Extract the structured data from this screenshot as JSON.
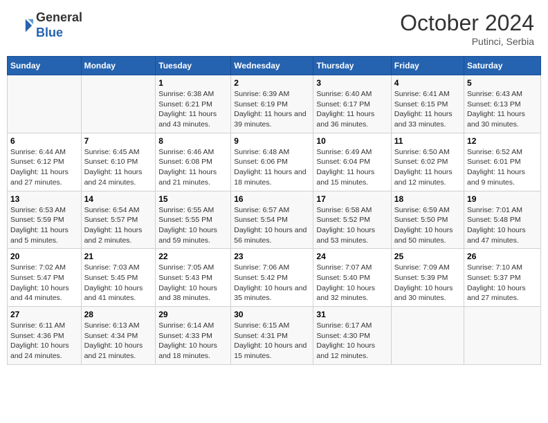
{
  "header": {
    "logo_line1": "General",
    "logo_line2": "Blue",
    "month_title": "October 2024",
    "location": "Putinci, Serbia"
  },
  "weekdays": [
    "Sunday",
    "Monday",
    "Tuesday",
    "Wednesday",
    "Thursday",
    "Friday",
    "Saturday"
  ],
  "weeks": [
    [
      {
        "day": "",
        "sunrise": "",
        "sunset": "",
        "daylight": ""
      },
      {
        "day": "",
        "sunrise": "",
        "sunset": "",
        "daylight": ""
      },
      {
        "day": "1",
        "sunrise": "Sunrise: 6:38 AM",
        "sunset": "Sunset: 6:21 PM",
        "daylight": "Daylight: 11 hours and 43 minutes."
      },
      {
        "day": "2",
        "sunrise": "Sunrise: 6:39 AM",
        "sunset": "Sunset: 6:19 PM",
        "daylight": "Daylight: 11 hours and 39 minutes."
      },
      {
        "day": "3",
        "sunrise": "Sunrise: 6:40 AM",
        "sunset": "Sunset: 6:17 PM",
        "daylight": "Daylight: 11 hours and 36 minutes."
      },
      {
        "day": "4",
        "sunrise": "Sunrise: 6:41 AM",
        "sunset": "Sunset: 6:15 PM",
        "daylight": "Daylight: 11 hours and 33 minutes."
      },
      {
        "day": "5",
        "sunrise": "Sunrise: 6:43 AM",
        "sunset": "Sunset: 6:13 PM",
        "daylight": "Daylight: 11 hours and 30 minutes."
      }
    ],
    [
      {
        "day": "6",
        "sunrise": "Sunrise: 6:44 AM",
        "sunset": "Sunset: 6:12 PM",
        "daylight": "Daylight: 11 hours and 27 minutes."
      },
      {
        "day": "7",
        "sunrise": "Sunrise: 6:45 AM",
        "sunset": "Sunset: 6:10 PM",
        "daylight": "Daylight: 11 hours and 24 minutes."
      },
      {
        "day": "8",
        "sunrise": "Sunrise: 6:46 AM",
        "sunset": "Sunset: 6:08 PM",
        "daylight": "Daylight: 11 hours and 21 minutes."
      },
      {
        "day": "9",
        "sunrise": "Sunrise: 6:48 AM",
        "sunset": "Sunset: 6:06 PM",
        "daylight": "Daylight: 11 hours and 18 minutes."
      },
      {
        "day": "10",
        "sunrise": "Sunrise: 6:49 AM",
        "sunset": "Sunset: 6:04 PM",
        "daylight": "Daylight: 11 hours and 15 minutes."
      },
      {
        "day": "11",
        "sunrise": "Sunrise: 6:50 AM",
        "sunset": "Sunset: 6:02 PM",
        "daylight": "Daylight: 11 hours and 12 minutes."
      },
      {
        "day": "12",
        "sunrise": "Sunrise: 6:52 AM",
        "sunset": "Sunset: 6:01 PM",
        "daylight": "Daylight: 11 hours and 9 minutes."
      }
    ],
    [
      {
        "day": "13",
        "sunrise": "Sunrise: 6:53 AM",
        "sunset": "Sunset: 5:59 PM",
        "daylight": "Daylight: 11 hours and 5 minutes."
      },
      {
        "day": "14",
        "sunrise": "Sunrise: 6:54 AM",
        "sunset": "Sunset: 5:57 PM",
        "daylight": "Daylight: 11 hours and 2 minutes."
      },
      {
        "day": "15",
        "sunrise": "Sunrise: 6:55 AM",
        "sunset": "Sunset: 5:55 PM",
        "daylight": "Daylight: 10 hours and 59 minutes."
      },
      {
        "day": "16",
        "sunrise": "Sunrise: 6:57 AM",
        "sunset": "Sunset: 5:54 PM",
        "daylight": "Daylight: 10 hours and 56 minutes."
      },
      {
        "day": "17",
        "sunrise": "Sunrise: 6:58 AM",
        "sunset": "Sunset: 5:52 PM",
        "daylight": "Daylight: 10 hours and 53 minutes."
      },
      {
        "day": "18",
        "sunrise": "Sunrise: 6:59 AM",
        "sunset": "Sunset: 5:50 PM",
        "daylight": "Daylight: 10 hours and 50 minutes."
      },
      {
        "day": "19",
        "sunrise": "Sunrise: 7:01 AM",
        "sunset": "Sunset: 5:48 PM",
        "daylight": "Daylight: 10 hours and 47 minutes."
      }
    ],
    [
      {
        "day": "20",
        "sunrise": "Sunrise: 7:02 AM",
        "sunset": "Sunset: 5:47 PM",
        "daylight": "Daylight: 10 hours and 44 minutes."
      },
      {
        "day": "21",
        "sunrise": "Sunrise: 7:03 AM",
        "sunset": "Sunset: 5:45 PM",
        "daylight": "Daylight: 10 hours and 41 minutes."
      },
      {
        "day": "22",
        "sunrise": "Sunrise: 7:05 AM",
        "sunset": "Sunset: 5:43 PM",
        "daylight": "Daylight: 10 hours and 38 minutes."
      },
      {
        "day": "23",
        "sunrise": "Sunrise: 7:06 AM",
        "sunset": "Sunset: 5:42 PM",
        "daylight": "Daylight: 10 hours and 35 minutes."
      },
      {
        "day": "24",
        "sunrise": "Sunrise: 7:07 AM",
        "sunset": "Sunset: 5:40 PM",
        "daylight": "Daylight: 10 hours and 32 minutes."
      },
      {
        "day": "25",
        "sunrise": "Sunrise: 7:09 AM",
        "sunset": "Sunset: 5:39 PM",
        "daylight": "Daylight: 10 hours and 30 minutes."
      },
      {
        "day": "26",
        "sunrise": "Sunrise: 7:10 AM",
        "sunset": "Sunset: 5:37 PM",
        "daylight": "Daylight: 10 hours and 27 minutes."
      }
    ],
    [
      {
        "day": "27",
        "sunrise": "Sunrise: 6:11 AM",
        "sunset": "Sunset: 4:36 PM",
        "daylight": "Daylight: 10 hours and 24 minutes."
      },
      {
        "day": "28",
        "sunrise": "Sunrise: 6:13 AM",
        "sunset": "Sunset: 4:34 PM",
        "daylight": "Daylight: 10 hours and 21 minutes."
      },
      {
        "day": "29",
        "sunrise": "Sunrise: 6:14 AM",
        "sunset": "Sunset: 4:33 PM",
        "daylight": "Daylight: 10 hours and 18 minutes."
      },
      {
        "day": "30",
        "sunrise": "Sunrise: 6:15 AM",
        "sunset": "Sunset: 4:31 PM",
        "daylight": "Daylight: 10 hours and 15 minutes."
      },
      {
        "day": "31",
        "sunrise": "Sunrise: 6:17 AM",
        "sunset": "Sunset: 4:30 PM",
        "daylight": "Daylight: 10 hours and 12 minutes."
      },
      {
        "day": "",
        "sunrise": "",
        "sunset": "",
        "daylight": ""
      },
      {
        "day": "",
        "sunrise": "",
        "sunset": "",
        "daylight": ""
      }
    ]
  ]
}
